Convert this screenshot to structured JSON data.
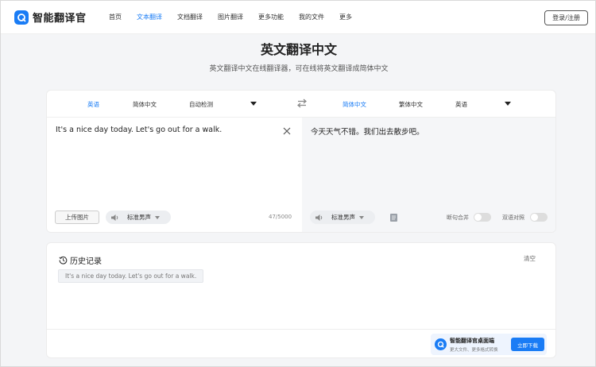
{
  "brand": {
    "name": "智能翻译官",
    "accent": "#1a7cf5"
  },
  "nav": {
    "items": [
      {
        "label": "首页",
        "active": false
      },
      {
        "label": "文本翻译",
        "active": true
      },
      {
        "label": "文档翻译",
        "active": false
      },
      {
        "label": "图片翻译",
        "active": false
      },
      {
        "label": "更多功能",
        "active": false
      },
      {
        "label": "我的文件",
        "active": false
      },
      {
        "label": "更多",
        "active": false
      }
    ],
    "login_label": "登录/注册"
  },
  "page": {
    "title": "英文翻译中文",
    "subtitle": "英文翻译中文在线翻译器，可在线将英文翻译成简体中文"
  },
  "translator": {
    "source_langs": [
      "英语",
      "简体中文",
      "自动检测"
    ],
    "target_langs": [
      "简体中文",
      "繁体中文",
      "英语"
    ],
    "source_text": "It's a nice day today. Let's go out for a walk.",
    "target_text": "今天天气不错。我们出去散步吧。",
    "upload_label": "上传图片",
    "voice_label": "标准男声",
    "char_count": "47/5000",
    "toggle_merge_label": "断句合并",
    "toggle_bilingual_label": "双语对照",
    "toggle_merge_on": false,
    "toggle_bilingual_on": false
  },
  "history": {
    "title": "历史记录",
    "clear_label": "清空",
    "items": [
      "It's a nice day today. Let's go out for a walk."
    ]
  },
  "promo": {
    "title": "智能翻译官桌面端",
    "subtitle": "更大文件、更多格式转换",
    "button_label": "立即下载"
  }
}
